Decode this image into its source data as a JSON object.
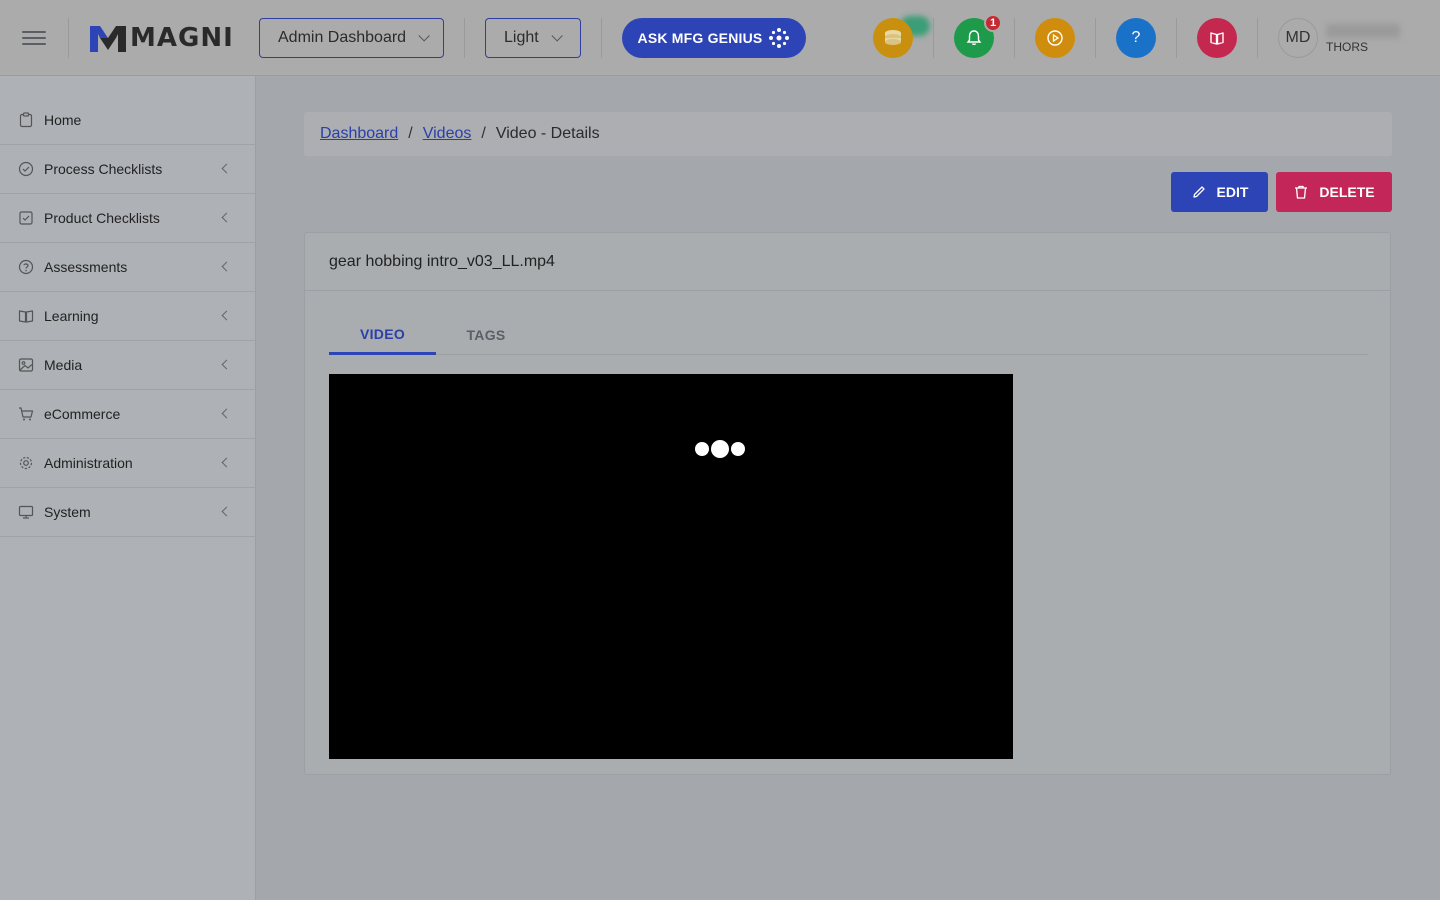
{
  "header": {
    "logo_text": "MAGNI",
    "dashboard_select": "Admin Dashboard",
    "theme_select": "Light",
    "ask_button": "ASK MFG GENIUS",
    "notification_count": "1",
    "help_label": "?",
    "user": {
      "initials": "MD",
      "org": "THORS"
    }
  },
  "sidebar": {
    "items": [
      {
        "label": "Home",
        "icon": "clipboard-icon"
      },
      {
        "label": "Process Checklists",
        "icon": "check-circle-icon"
      },
      {
        "label": "Product Checklists",
        "icon": "check-square-icon"
      },
      {
        "label": "Assessments",
        "icon": "question-circle-icon"
      },
      {
        "label": "Learning",
        "icon": "book-icon"
      },
      {
        "label": "Media",
        "icon": "image-icon"
      },
      {
        "label": "eCommerce",
        "icon": "cart-icon"
      },
      {
        "label": "Administration",
        "icon": "gear-icon"
      },
      {
        "label": "System",
        "icon": "monitor-icon"
      }
    ]
  },
  "breadcrumb": {
    "items": [
      "Dashboard",
      "Videos",
      "Video - Details"
    ],
    "separator": "/"
  },
  "actions": {
    "edit": "EDIT",
    "delete": "DELETE"
  },
  "card": {
    "title": "gear hobbing intro_v03_LL.mp4",
    "tabs": [
      "VIDEO",
      "TAGS"
    ],
    "active_tab": "VIDEO"
  },
  "colors": {
    "primary": "#2d44b6",
    "danger": "#c3275a",
    "coins": "#c8900e",
    "notifications": "#1e9a4b",
    "video": "#d08c0c",
    "help": "#1a72c8",
    "book": "#c4284f"
  }
}
